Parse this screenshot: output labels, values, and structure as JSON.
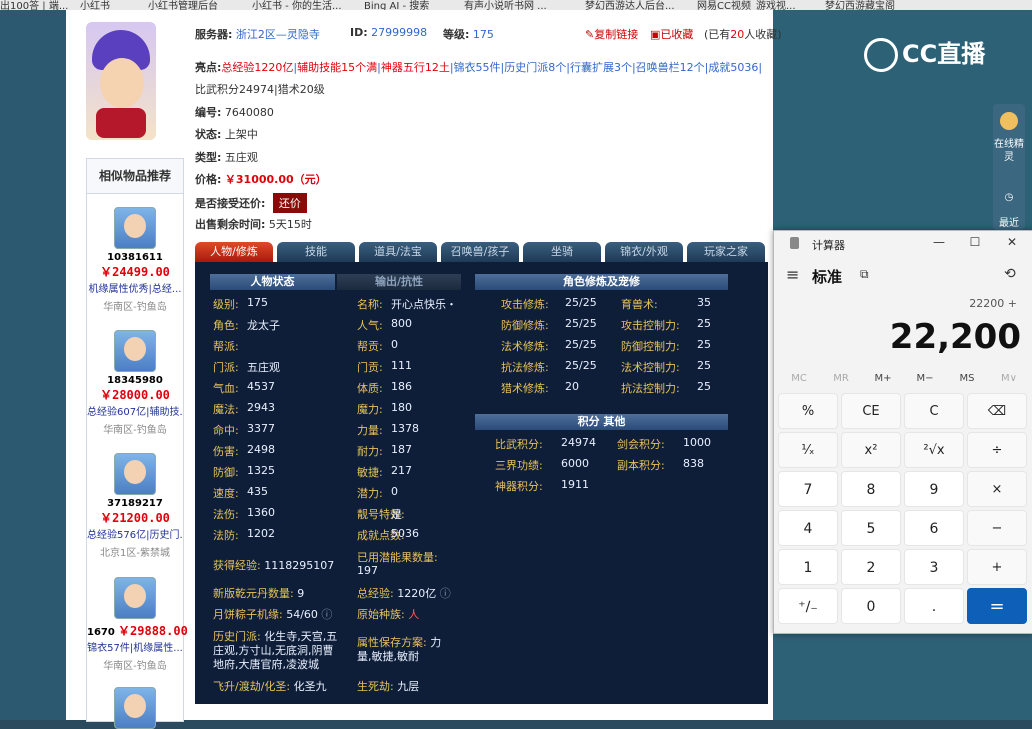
{
  "bookmarks": [
    "出100答 | 端...",
    "小红书",
    "小红书管理后台",
    "小红书 - 你的生活...",
    "Bing AI - 搜索",
    "有声小说听书网 ...",
    "梦幻西游达人后台...",
    "网易CC视频_游戏视...",
    "梦幻西游藏宝阁"
  ],
  "header": {
    "server_label": "服务器:",
    "server_value": "浙江2区—灵隐寺",
    "id_label": "ID:",
    "id_value": "27999998",
    "level_label": "等级:",
    "level_value": "175",
    "copy_link": "复制链接",
    "collected": "已收藏",
    "collect_prefix": "(已有",
    "collect_count": "20",
    "collect_suffix": "人收藏)"
  },
  "highlights": {
    "label": "亮点:",
    "line1_red": "总经验1220亿",
    "line1_sep1": "|",
    "line1_red2": "辅助技能15个满",
    "line1_sep2": "|",
    "line1_red3": "神器五行12土",
    "line1_rest": "|锦衣55件|历史门派8个|行囊扩展3个|召唤兽栏12个|成就5036|",
    "line2": "比武积分24974|猎术20级"
  },
  "item": {
    "no_label": "编号:",
    "no_value": "7640080",
    "status_label": "状态:",
    "status_value": "上架中",
    "type_label": "类型:",
    "type_value": "五庄观",
    "price_label": "价格:",
    "price_value": "￥31000.00（元）",
    "bargain_label": "是否接受还价:",
    "bargain_button": "还价",
    "remain_label": "出售剩余时间:",
    "remain_value": "5天15时"
  },
  "similar": {
    "title": "相似物品推荐",
    "items": [
      {
        "id": "10381611",
        "price": "￥24499.00",
        "tag": "机缘属性优秀|总经...",
        "server": "华南区-钓鱼岛"
      },
      {
        "id": "18345980",
        "price": "￥28000.00",
        "tag": "总经验607亿|辅助技...",
        "server": "华南区-钓鱼岛"
      },
      {
        "id": "37189217",
        "price": "￥21200.00",
        "tag": "总经验576亿|历史门...",
        "server": "北京1区-紫禁城"
      },
      {
        "id": "1670",
        "price": "￥29888.00",
        "tag": "锦衣57件|机缘属性...",
        "server": "华南区-钓鱼岛"
      }
    ],
    "badge": "售"
  },
  "tabs": [
    "人物/修炼",
    "技能",
    "道具/法宝",
    "召唤兽/孩子",
    "坐骑",
    "锦衣/外观",
    "玩家之家"
  ],
  "panel": {
    "sec_status": "人物状态",
    "sec_output": "输出/抗性",
    "sec_cultivation": "角色修炼及宠修",
    "sec_points": "积分 其他",
    "left": [
      {
        "k": "级别:",
        "v": "175"
      },
      {
        "k": "角色:",
        "v": "龙太子"
      },
      {
        "k": "帮派:",
        "v": ""
      },
      {
        "k": "门派:",
        "v": "五庄观"
      },
      {
        "k": "气血:",
        "v": "4537"
      },
      {
        "k": "魔法:",
        "v": "2943"
      },
      {
        "k": "命中:",
        "v": "3377"
      },
      {
        "k": "伤害:",
        "v": "2498"
      },
      {
        "k": "防御:",
        "v": "1325"
      },
      {
        "k": "速度:",
        "v": "435"
      },
      {
        "k": "法伤:",
        "v": "1360"
      },
      {
        "k": "法防:",
        "v": "1202"
      }
    ],
    "mid": [
      {
        "k": "名称:",
        "v": "开心点快乐・"
      },
      {
        "k": "人气:",
        "v": "800"
      },
      {
        "k": "帮贡:",
        "v": "0"
      },
      {
        "k": "门贡:",
        "v": "111"
      },
      {
        "k": "体质:",
        "v": "186"
      },
      {
        "k": "魔力:",
        "v": "180"
      },
      {
        "k": "力量:",
        "v": "1378"
      },
      {
        "k": "耐力:",
        "v": "187"
      },
      {
        "k": "敏捷:",
        "v": "217"
      },
      {
        "k": "潜力:",
        "v": "0"
      },
      {
        "k": "靓号特效:",
        "v": "是"
      },
      {
        "k": "成就点数:",
        "v": "5036"
      }
    ],
    "exp_label": "获得经验:",
    "exp_value": "1118295107",
    "used_label": "已用潜能果数量:",
    "used_value": "197",
    "qianyuan_label": "新版乾元丹数量:",
    "qianyuan_value": "9",
    "total_label": "总经验:",
    "total_value": "1220亿",
    "zongzi_label": "月饼粽子机缘:",
    "zongzi_value": "54/60",
    "origin_label": "原始种族:",
    "origin_value": "人",
    "history_label": "历史门派:",
    "history_value_1": "化生寺,天宫,五",
    "history_value_2": "庄观,方寸山,无底洞,阴曹",
    "history_value_3": "地府,大唐官府,凌波城",
    "attr_label": "属性保存方案:",
    "attr_value_1": "力",
    "attr_value_2": "量,敏捷,敏耐",
    "fly_label": "飞升/渡劫/化圣:",
    "fly_value": "化圣九",
    "life_label": "生死劫:",
    "life_value": "九层",
    "cult_left": [
      {
        "k": "攻击修炼:",
        "v": "25/25"
      },
      {
        "k": "防御修炼:",
        "v": "25/25"
      },
      {
        "k": "法术修炼:",
        "v": "25/25"
      },
      {
        "k": "抗法修炼:",
        "v": "25/25"
      },
      {
        "k": "猎术修炼:",
        "v": "20"
      }
    ],
    "cult_right": [
      {
        "k": "育兽术:",
        "v": "35"
      },
      {
        "k": "攻击控制力:",
        "v": "25"
      },
      {
        "k": "防御控制力:",
        "v": "25"
      },
      {
        "k": "法术控制力:",
        "v": "25"
      },
      {
        "k": "抗法控制力:",
        "v": "25"
      }
    ],
    "points": [
      {
        "k": "比武积分:",
        "v": "24974"
      },
      {
        "k": "三界功绩:",
        "v": "6000"
      },
      {
        "k": "神器积分:",
        "v": "1911"
      }
    ],
    "points_right": [
      {
        "k": "剑会积分:",
        "v": "1000"
      },
      {
        "k": "副本积分:",
        "v": "838"
      }
    ]
  },
  "calculator": {
    "title": "计算器",
    "mode": "标准",
    "expression": "22200 +",
    "display": "22,200",
    "memory": [
      "MC",
      "MR",
      "M+",
      "M−",
      "MS",
      "M∨"
    ],
    "keys": [
      "%",
      "CE",
      "C",
      "⌫",
      "¹⁄ₓ",
      "x²",
      "²√x",
      "÷",
      "7",
      "8",
      "9",
      "×",
      "4",
      "5",
      "6",
      "−",
      "1",
      "2",
      "3",
      "+",
      "⁺∕₋",
      "0",
      ".",
      "="
    ]
  },
  "cc_logo": "CC直播",
  "floating": {
    "online": "在线精灵",
    "recent": "最近"
  }
}
